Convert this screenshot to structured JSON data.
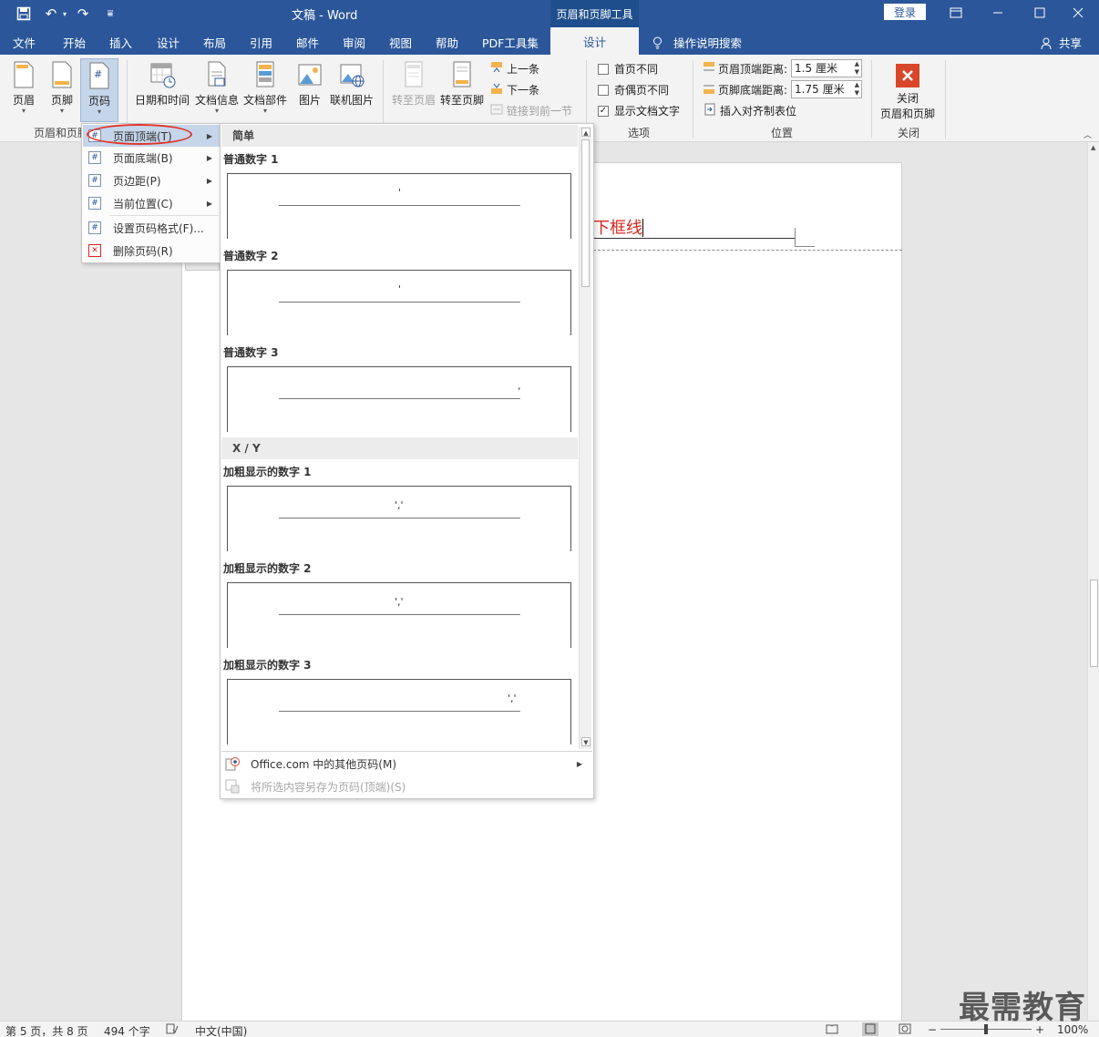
{
  "titlebar": {
    "doc_title": "文稿  -  Word",
    "tools_title": "页眉和页脚工具",
    "login": "登录",
    "undo_icon": "↶",
    "redo_icon": "↷",
    "customize_icon": "⩸"
  },
  "tabs": {
    "items": [
      "文件",
      "开始",
      "插入",
      "设计",
      "布局",
      "引用",
      "邮件",
      "审阅",
      "视图",
      "帮助",
      "PDF工具集"
    ],
    "active": "设计",
    "tell_me": "操作说明搜索",
    "share": "共享"
  },
  "ribbon": {
    "header_btn": "页眉",
    "footer_btn": "页脚",
    "pagenum_btn": "页码",
    "group1_label": "页眉和页脚",
    "datetime_btn": "日期和时间",
    "docinfo_btn": "文档信息",
    "quickparts_btn": "文档部件",
    "picture_btn": "图片",
    "online_pic_btn": "联机图片",
    "goto_header_btn": "转至页眉",
    "goto_footer_btn": "转至页脚",
    "prev_btn": "上一条",
    "next_btn": "下一条",
    "link_prev_btn": "链接到前一节",
    "opt_first_page": "首页不同",
    "opt_odd_even": "奇偶页不同",
    "opt_show_text": "显示文档文字",
    "options_label": "选项",
    "header_dist_label": "页眉顶端距离:",
    "header_dist_value": "1.5 厘米",
    "footer_dist_label": "页脚底端距离:",
    "footer_dist_value": "1.75 厘米",
    "align_tab": "插入对齐制表位",
    "position_label": "位置",
    "close_btn_line1": "关闭",
    "close_btn_line2": "页眉和页脚",
    "close_label": "关闭"
  },
  "pagenum_menu": {
    "items": [
      {
        "label": "页面顶端(T)",
        "submenu": true,
        "active": true
      },
      {
        "label": "页面底端(B)",
        "submenu": true
      },
      {
        "label": "页边距(P)",
        "submenu": true
      },
      {
        "label": "当前位置(C)",
        "submenu": true
      },
      {
        "label": "设置页码格式(F)..."
      },
      {
        "label": "删除页码(R)"
      }
    ]
  },
  "gallery": {
    "section1": "简单",
    "section2": "X / Y",
    "items": [
      {
        "label": "普通数字 1",
        "num": "'"
      },
      {
        "label": "普通数字 2",
        "num": "'"
      },
      {
        "label": "普通数字 3",
        "num": ","
      },
      {
        "label": "加粗显示的数字 1",
        "num": "','"
      },
      {
        "label": "加粗显示的数字 2",
        "num": "','"
      },
      {
        "label": "加粗显示的数字 3",
        "num": "','"
      }
    ],
    "more_online": "Office.com 中的其他页码(M)",
    "save_selection": "将所选内容另存为页码(顶端)(S)"
  },
  "document": {
    "header_text": "下框线"
  },
  "statusbar": {
    "page": "第 5 页，共 8 页",
    "words": "494 个字",
    "language": "中文(中国)",
    "zoom": "100%"
  },
  "watermark": "最需教育",
  "colors": {
    "accent": "#2b579a",
    "header_text": "#d9261c",
    "annotation_circle": "#e0352b"
  }
}
